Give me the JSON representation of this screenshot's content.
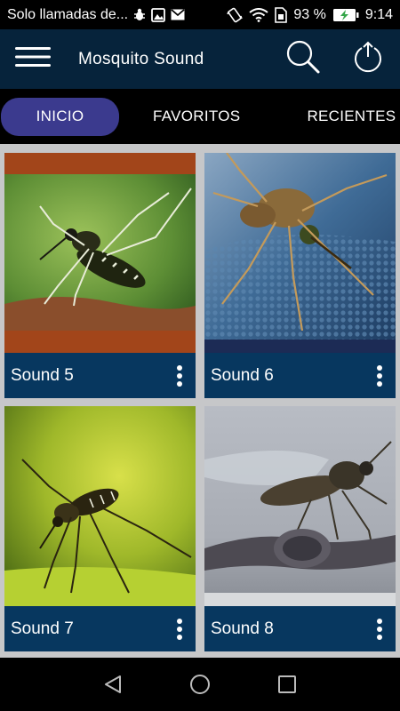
{
  "status_bar": {
    "notification_text": "Solo llamadas de...",
    "battery_percent": "93 %",
    "time": "9:14",
    "icons": [
      "bug-icon",
      "image-icon",
      "gmail-icon",
      "vibrate-icon",
      "wifi-icon",
      "sim-icon",
      "battery-charging-icon"
    ]
  },
  "app_bar": {
    "title": "Mosquito Sound",
    "color": "#06233b",
    "icons": [
      "menu-icon",
      "search-icon",
      "power-icon"
    ]
  },
  "tabs": [
    {
      "label": "INICIO",
      "active": true
    },
    {
      "label": "FAVORITOS",
      "active": false
    },
    {
      "label": "RECIENTES",
      "active": false
    }
  ],
  "active_tab_color": "#3b3a8e",
  "grid": {
    "card_bar_color": "#07375f",
    "items": [
      {
        "label": "Sound 5",
        "image": "mosquito-on-skin-photo"
      },
      {
        "label": "Sound 6",
        "image": "mosquito-on-fabric-photo"
      },
      {
        "label": "Sound 7",
        "image": "mosquito-on-leaf-photo"
      },
      {
        "label": "Sound 8",
        "image": "mosquito-on-twig-photo"
      }
    ]
  },
  "nav_bar": {
    "icons": [
      "back-icon",
      "home-icon",
      "recents-icon"
    ]
  }
}
